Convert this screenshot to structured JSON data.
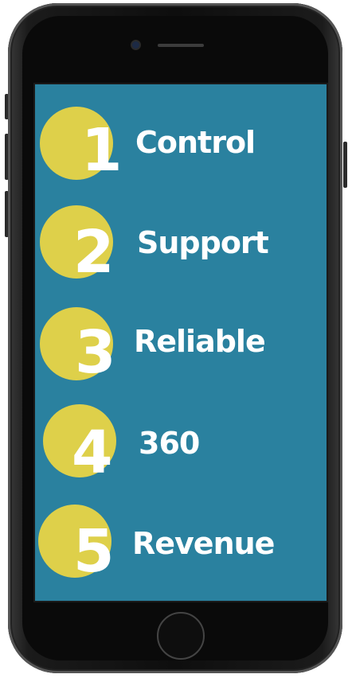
{
  "colors": {
    "screen_background": "#2a819f",
    "circle": "#ded04a",
    "text": "#ffffff"
  },
  "items": [
    {
      "number": "1",
      "label": "Control"
    },
    {
      "number": "2",
      "label": "Support"
    },
    {
      "number": "3",
      "label": "Reliable"
    },
    {
      "number": "4",
      "label": "360"
    },
    {
      "number": "5",
      "label": "Revenue"
    }
  ]
}
